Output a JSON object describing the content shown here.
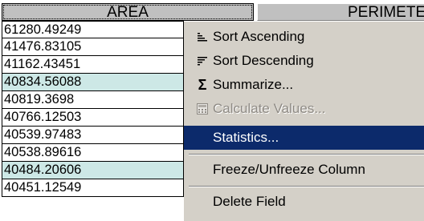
{
  "columns": {
    "area": "AREA",
    "perimeter": "PERIMETER"
  },
  "rows": [
    {
      "value": "61280.49249",
      "selected": false
    },
    {
      "value": "41476.83105",
      "selected": false
    },
    {
      "value": "41162.43451",
      "selected": false
    },
    {
      "value": "40834.56088",
      "selected": true
    },
    {
      "value": "40819.3698",
      "selected": false
    },
    {
      "value": "40766.12503",
      "selected": false
    },
    {
      "value": "40539.97483",
      "selected": false
    },
    {
      "value": "40538.89616",
      "selected": false
    },
    {
      "value": "40484.20606",
      "selected": true
    },
    {
      "value": "40451.12549",
      "selected": false
    }
  ],
  "menu": {
    "sort_ascending": "Sort Ascending",
    "sort_descending": "Sort Descending",
    "summarize": "Summarize...",
    "calculate_values": "Calculate Values...",
    "statistics": "Statistics...",
    "freeze_column": "Freeze/Unfreeze Column",
    "delete_field": "Delete Field"
  },
  "colors": {
    "selected_row": "#cde8e6",
    "highlight": "#0c2a6b",
    "menu_bg": "#d4d0c8"
  },
  "icons": {
    "sort_ascending": "sort-ascending-icon",
    "sort_descending": "sort-descending-icon",
    "summarize": "sigma-icon",
    "calculate_values": "calculator-icon"
  }
}
